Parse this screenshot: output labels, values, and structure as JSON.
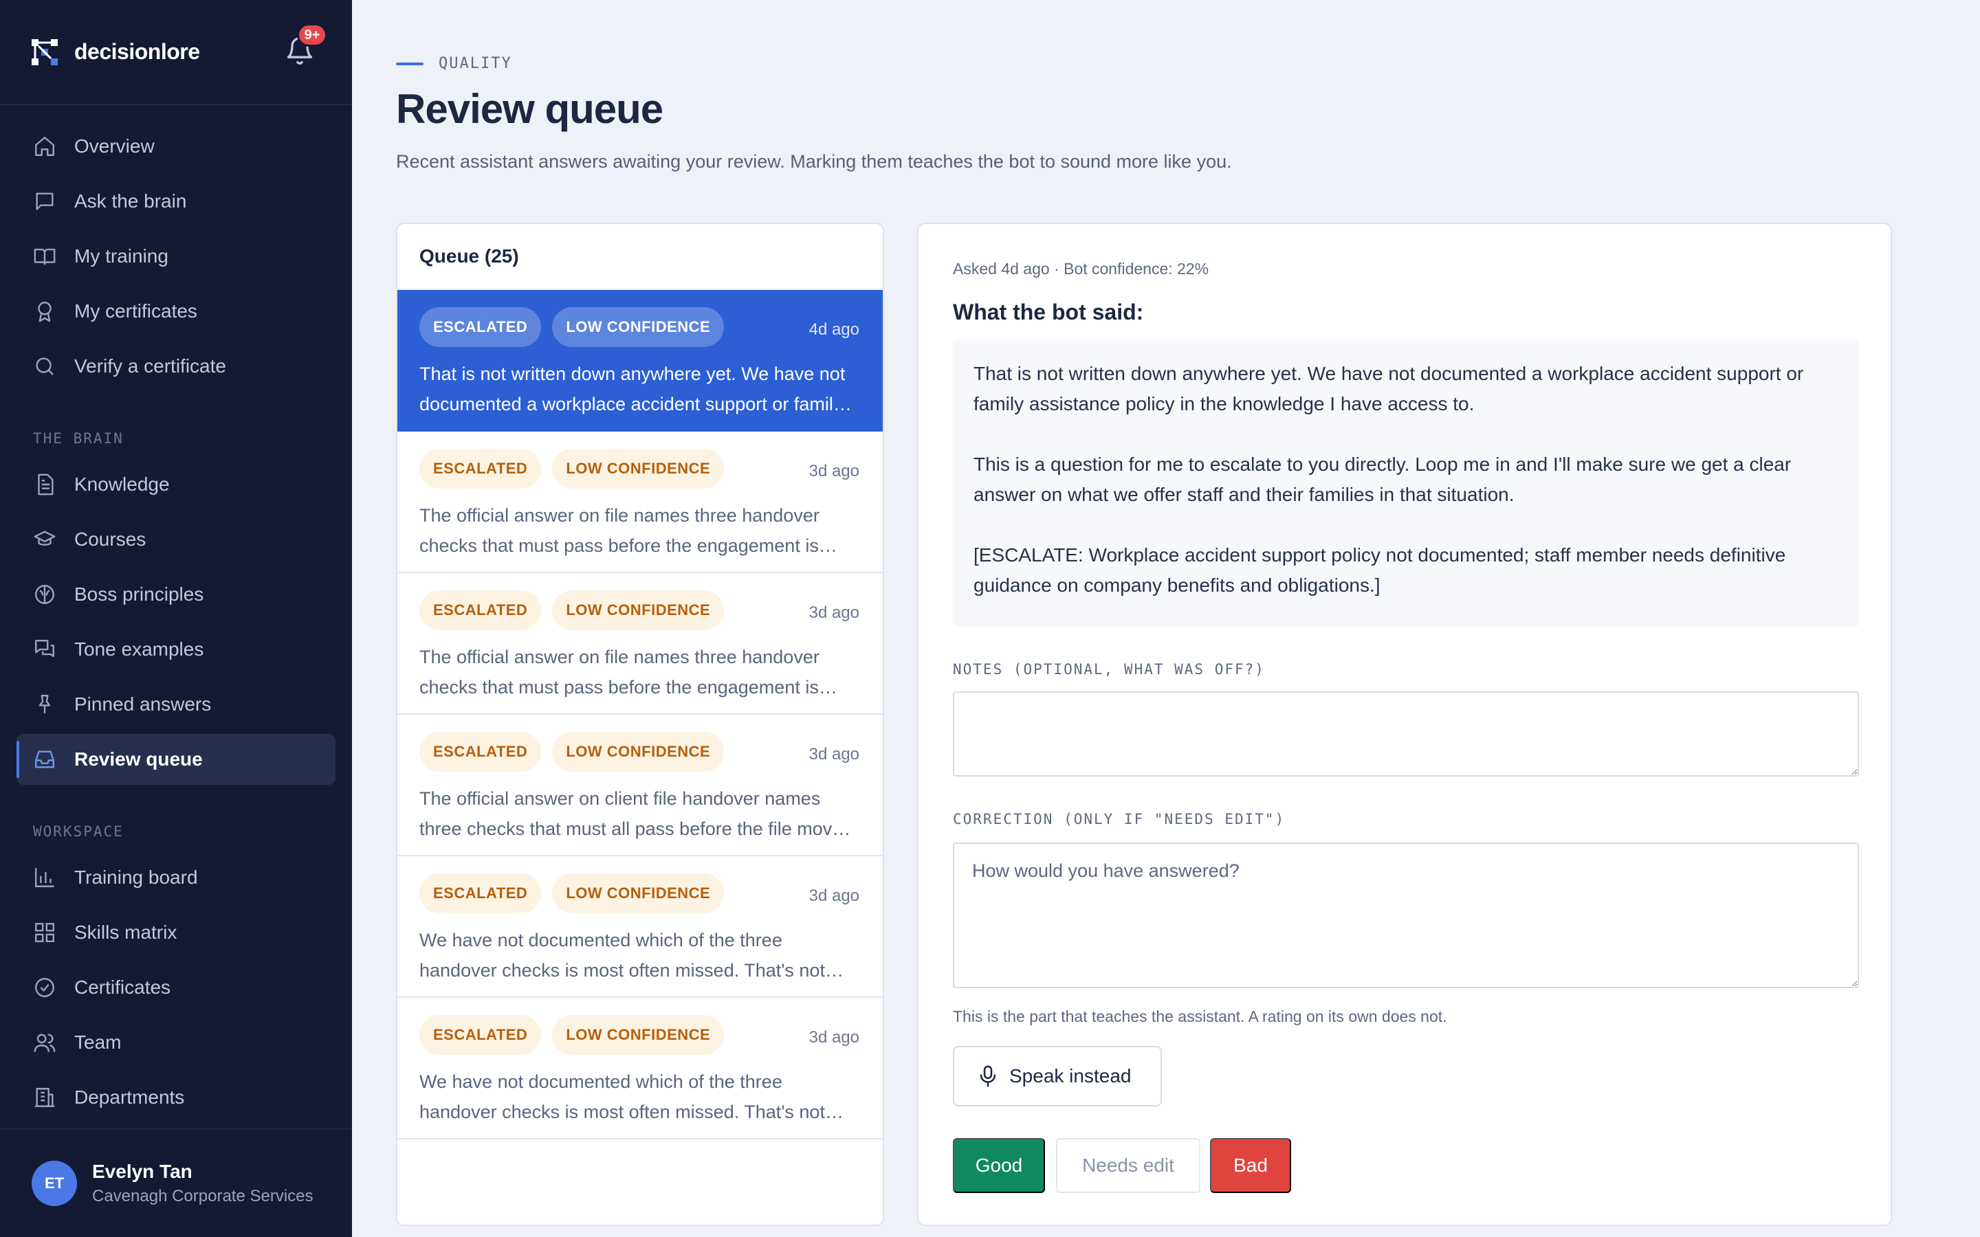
{
  "brand": {
    "name": "decisionlore",
    "notifications_badge": "9+"
  },
  "nav": {
    "main": [
      {
        "label": "Overview",
        "icon": "home-icon"
      },
      {
        "label": "Ask the brain",
        "icon": "chat-icon"
      },
      {
        "label": "My training",
        "icon": "book-icon"
      },
      {
        "label": "My certificates",
        "icon": "award-icon"
      },
      {
        "label": "Verify a certificate",
        "icon": "search-icon"
      }
    ],
    "brain_section": "THE BRAIN",
    "brain": [
      {
        "label": "Knowledge",
        "icon": "document-icon"
      },
      {
        "label": "Courses",
        "icon": "graduation-cap-icon"
      },
      {
        "label": "Boss principles",
        "icon": "brain-icon"
      },
      {
        "label": "Tone examples",
        "icon": "messages-icon"
      },
      {
        "label": "Pinned answers",
        "icon": "pin-icon"
      },
      {
        "label": "Review queue",
        "icon": "inbox-icon",
        "active": true
      }
    ],
    "workspace_section": "WORKSPACE",
    "workspace": [
      {
        "label": "Training board",
        "icon": "bar-chart-icon"
      },
      {
        "label": "Skills matrix",
        "icon": "grid-icon"
      },
      {
        "label": "Certificates",
        "icon": "badge-check-icon"
      },
      {
        "label": "Team",
        "icon": "users-icon"
      },
      {
        "label": "Departments",
        "icon": "building-icon"
      }
    ]
  },
  "user": {
    "initials": "ET",
    "name": "Evelyn Tan",
    "org": "Cavenagh Corporate Services"
  },
  "header": {
    "eyebrow": "QUALITY",
    "title": "Review queue",
    "subtitle": "Recent assistant answers awaiting your review. Marking them teaches the bot to sound more like you."
  },
  "queue": {
    "title": "Queue (25)",
    "items": [
      {
        "tags": [
          "ESCALATED",
          "LOW CONFIDENCE"
        ],
        "time": "4d ago",
        "text": "That is not written down anywhere yet. We have not documented a workplace accident support or family assistance policy in the knowledge I have access to.",
        "selected": true
      },
      {
        "tags": [
          "ESCALATED",
          "LOW CONFIDENCE"
        ],
        "time": "3d ago",
        "text": "The official answer on file names three handover checks that must pass before the engagement is handed over."
      },
      {
        "tags": [
          "ESCALATED",
          "LOW CONFIDENCE"
        ],
        "time": "3d ago",
        "text": "The official answer on file names three handover checks that must pass before the engagement is handed over."
      },
      {
        "tags": [
          "ESCALATED",
          "LOW CONFIDENCE"
        ],
        "time": "3d ago",
        "text": "The official answer on client file handover names three checks that must all pass before the file moves on."
      },
      {
        "tags": [
          "ESCALATED",
          "LOW CONFIDENCE"
        ],
        "time": "3d ago",
        "text": "We have not documented which of the three handover checks is most often missed. That's not something I can answer yet."
      },
      {
        "tags": [
          "ESCALATED",
          "LOW CONFIDENCE"
        ],
        "time": "3d ago",
        "text": "We have not documented which of the three handover checks is most often missed. That's not something I can answer yet."
      }
    ]
  },
  "detail": {
    "meta": "Asked 4d ago · Bot confidence: 22%",
    "said_title": "What the bot said:",
    "paragraphs": [
      "That is not written down anywhere yet. We have not documented a workplace accident support or family assistance policy in the knowledge I have access to.",
      "This is a question for me to escalate to you directly. Loop me in and I'll make sure we get a clear answer on what we offer staff and their families in that situation.",
      "[ESCALATE: Workplace accident support policy not documented; staff member needs definitive guidance on company benefits and obligations.]"
    ],
    "notes_label": "NOTES (OPTIONAL, WHAT WAS OFF?)",
    "notes_value": "",
    "correction_label": "CORRECTION (ONLY IF \"NEEDS EDIT\")",
    "correction_placeholder": "How would you have answered?",
    "hint": "This is the part that teaches the assistant. A rating on its own does not.",
    "speak_label": "Speak instead",
    "good_label": "Good",
    "needs_edit_label": "Needs edit",
    "bad_label": "Bad"
  },
  "colors": {
    "accent": "#2c5fd3",
    "sidebar": "#141a33",
    "good": "#0f8a5f",
    "bad": "#e0443f",
    "tag_text": "#b65f0b",
    "tag_bg": "#fdf3e3"
  }
}
